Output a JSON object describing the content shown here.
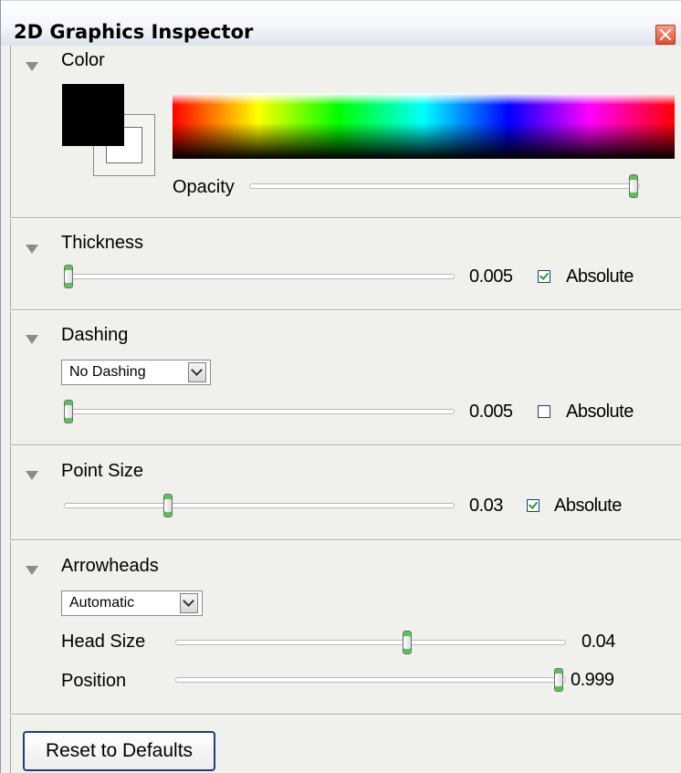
{
  "window": {
    "title": "2D Graphics Inspector",
    "close_icon": "close-icon"
  },
  "color_section": {
    "label": "Color",
    "foreground_color": "#000000",
    "background_color": "#ffffff",
    "opacity_label": "Opacity",
    "opacity_value": 1.0
  },
  "thickness_section": {
    "label": "Thickness",
    "value": "0.005",
    "absolute_label": "Absolute",
    "absolute_checked": true
  },
  "dashing_section": {
    "label": "Dashing",
    "dropdown_value": "No Dashing",
    "value": "0.005",
    "absolute_label": "Absolute",
    "absolute_checked": false
  },
  "point_size_section": {
    "label": "Point Size",
    "value": "0.03",
    "absolute_label": "Absolute",
    "absolute_checked": true
  },
  "arrowheads_section": {
    "label": "Arrowheads",
    "dropdown_value": "Automatic",
    "head_size_label": "Head Size",
    "head_size_value": "0.04",
    "position_label": "Position",
    "position_value": "0.999"
  },
  "footer": {
    "reset_label": "Reset to Defaults"
  }
}
